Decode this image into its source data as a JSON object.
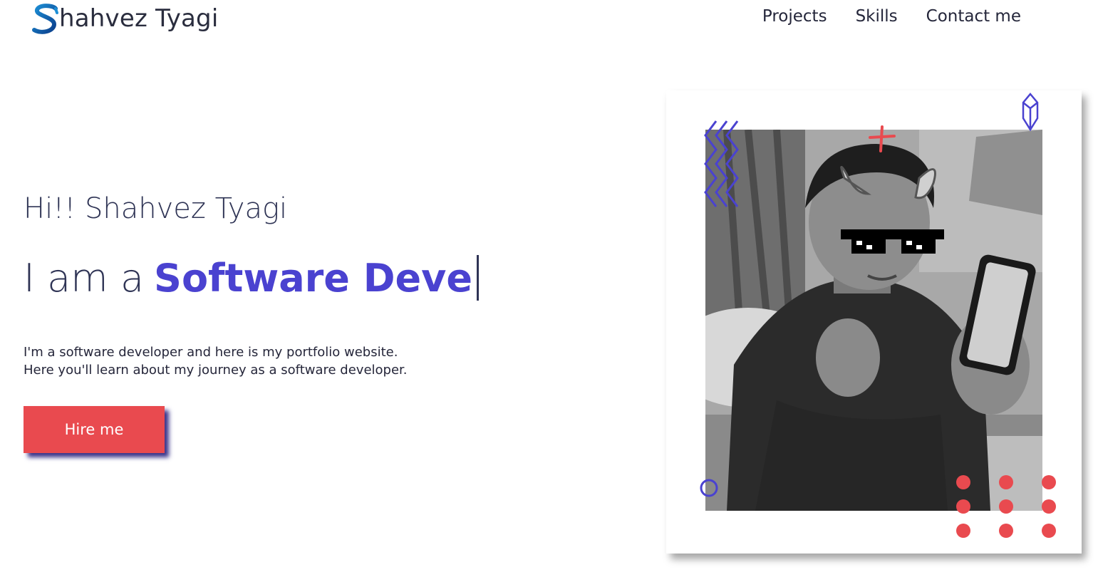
{
  "header": {
    "logo_text": "hahvez Tyagi",
    "logo_icon": "stylized-s-logo",
    "nav": [
      {
        "label": "Projects"
      },
      {
        "label": "Skills"
      },
      {
        "label": "Contact me"
      }
    ]
  },
  "hero": {
    "greeting": "Hi!! Shahvez Tyagi",
    "role_prefix": "I am a",
    "role_typed": "Software Deve",
    "intro_line1": "I'm a software developer and here is my portfolio website.",
    "intro_line2": "Here you'll learn about my journey as a software developer.",
    "hire_label": "Hire me"
  },
  "photo": {
    "description_icon": "profile-photo"
  },
  "colors": {
    "accent": "#4a42d0",
    "button": "#e94a4f",
    "text": "#2f3455"
  }
}
